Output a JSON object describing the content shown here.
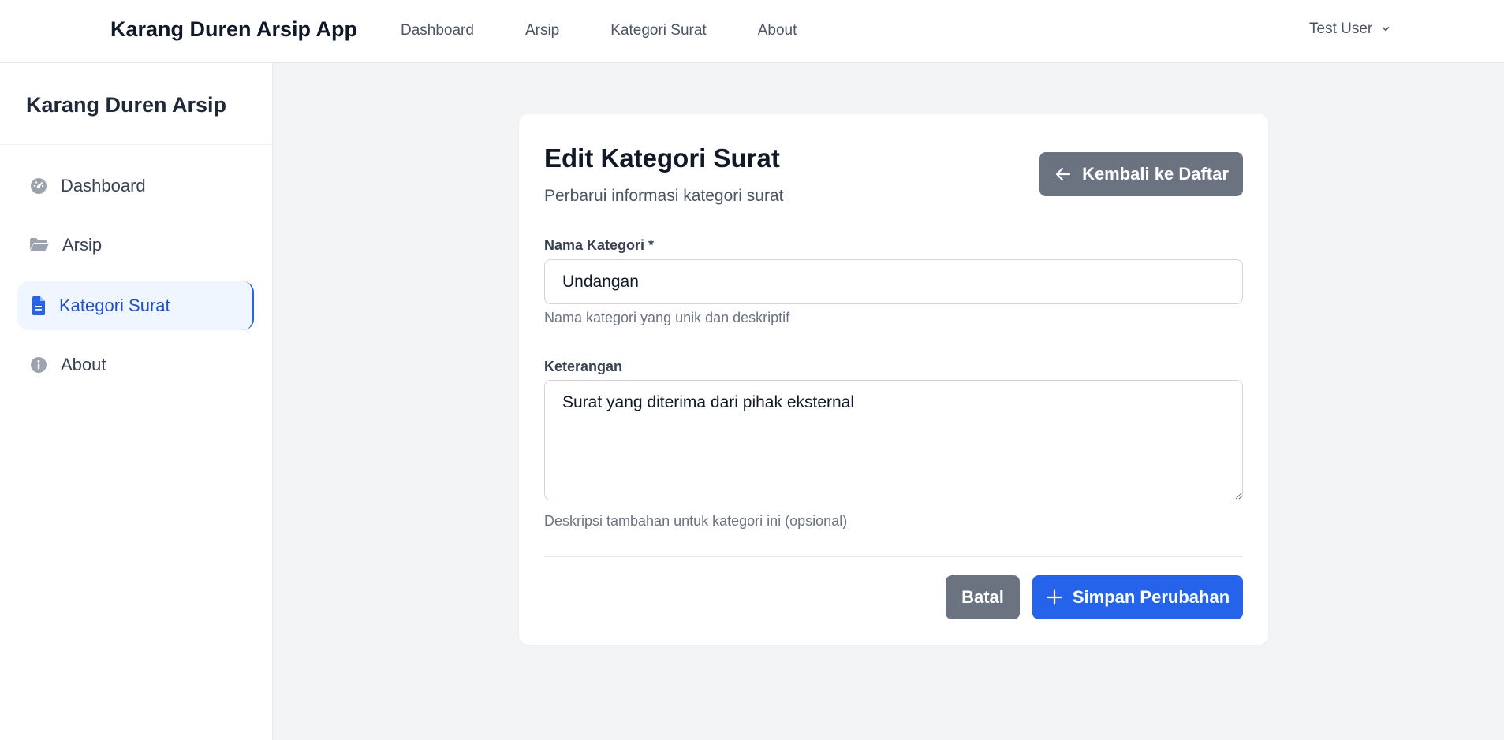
{
  "app": {
    "title": "Karang Duren Arsip App"
  },
  "topnav": {
    "items": [
      "Dashboard",
      "Arsip",
      "Kategori Surat",
      "About"
    ]
  },
  "user": {
    "name": "Test User"
  },
  "sidebar": {
    "brand": "Karang Duren Arsip",
    "items": [
      {
        "label": "Dashboard",
        "icon": "gauge-icon"
      },
      {
        "label": "Arsip",
        "icon": "folder-open-icon"
      },
      {
        "label": "Kategori Surat",
        "icon": "file-icon",
        "active": true
      },
      {
        "label": "About",
        "icon": "info-circle-icon"
      }
    ]
  },
  "form": {
    "title": "Edit Kategori Surat",
    "subtitle": "Perbarui informasi kategori surat",
    "back_label": "Kembali ke Daftar",
    "name_label": "Nama Kategori *",
    "name_value": "Undangan",
    "name_help": "Nama kategori yang unik dan deskriptif",
    "desc_label": "Keterangan",
    "desc_value": "Surat yang diterima dari pihak eksternal",
    "desc_help": "Deskripsi tambahan untuk kategori ini (opsional)",
    "cancel_label": "Batal",
    "save_label": "Simpan Perubahan"
  },
  "colors": {
    "primary": "#2563eb",
    "secondary": "#6b7280",
    "active_bg": "#eff6ff"
  }
}
